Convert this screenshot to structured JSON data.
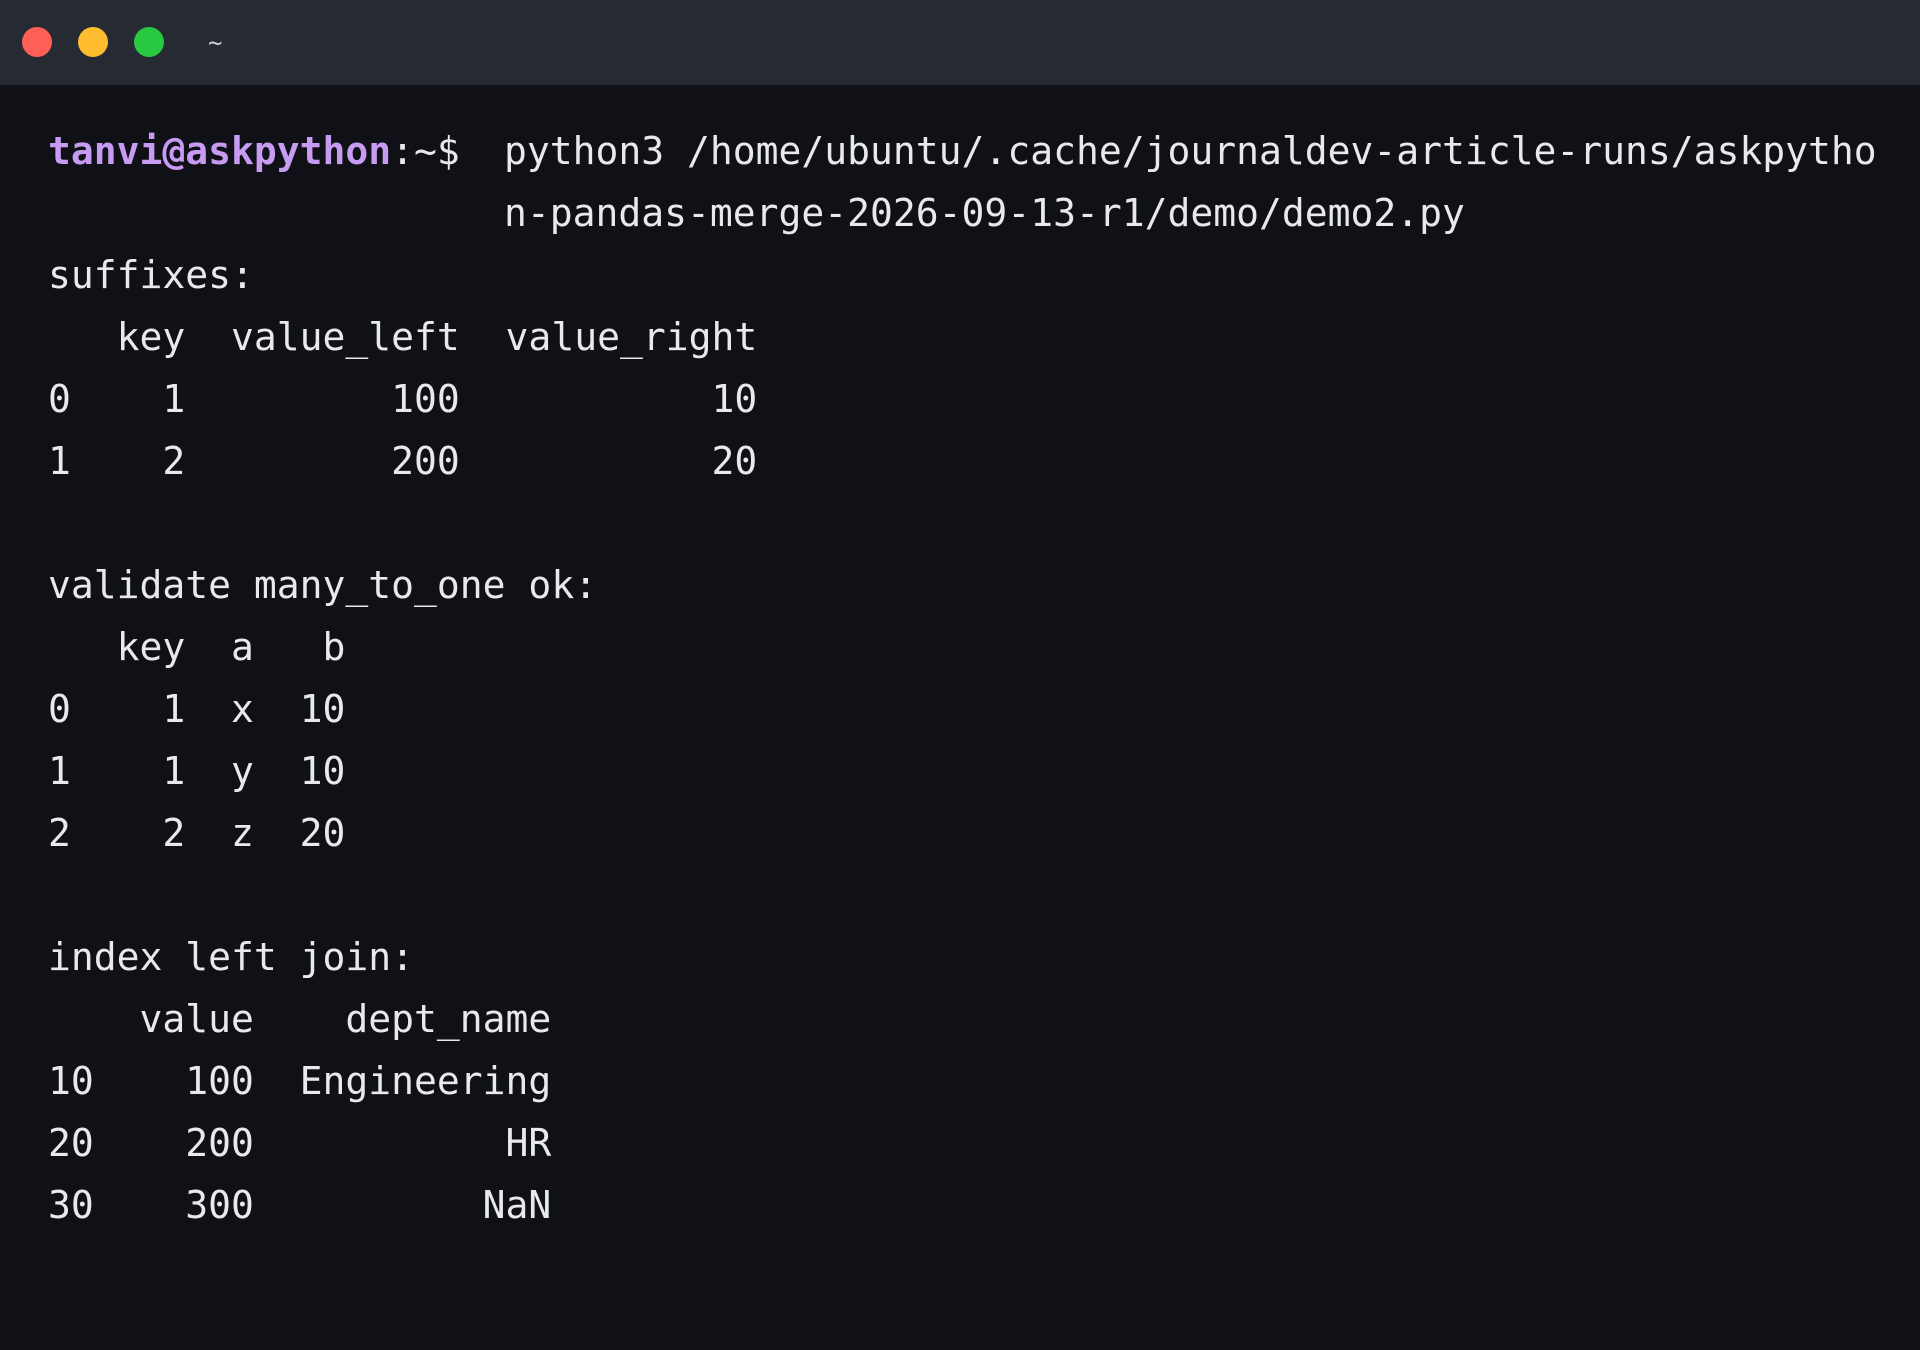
{
  "window": {
    "title": "~"
  },
  "terminal": {
    "prompt_user": "tanvi@askpython",
    "prompt_path": ":~$ ",
    "command": "python3 /home/ubuntu/.cache/journaldev-article-runs/askpython-pandas-merge-2026-09-13-r1/demo/demo2.py",
    "sections": [
      {
        "header": "suffixes:",
        "rows": [
          "   key  value_left  value_right",
          "0    1         100           10",
          "1    2         200           20"
        ]
      },
      {
        "header": "validate many_to_one ok:",
        "rows": [
          "   key  a   b",
          "0    1  x  10",
          "1    1  y  10",
          "2    2  z  20"
        ]
      },
      {
        "header": "index left join:",
        "rows": [
          "    value    dept_name",
          "10    100  Engineering",
          "20    200           HR",
          "30    300          NaN"
        ]
      }
    ]
  },
  "colors": {
    "background": "#0f1117",
    "titlebar": "#262a33",
    "prompt_user": "#c79bf2",
    "text": "#e7e9ee",
    "close": "#ff5f57",
    "minimize": "#febc2e",
    "maximize": "#28c840"
  }
}
